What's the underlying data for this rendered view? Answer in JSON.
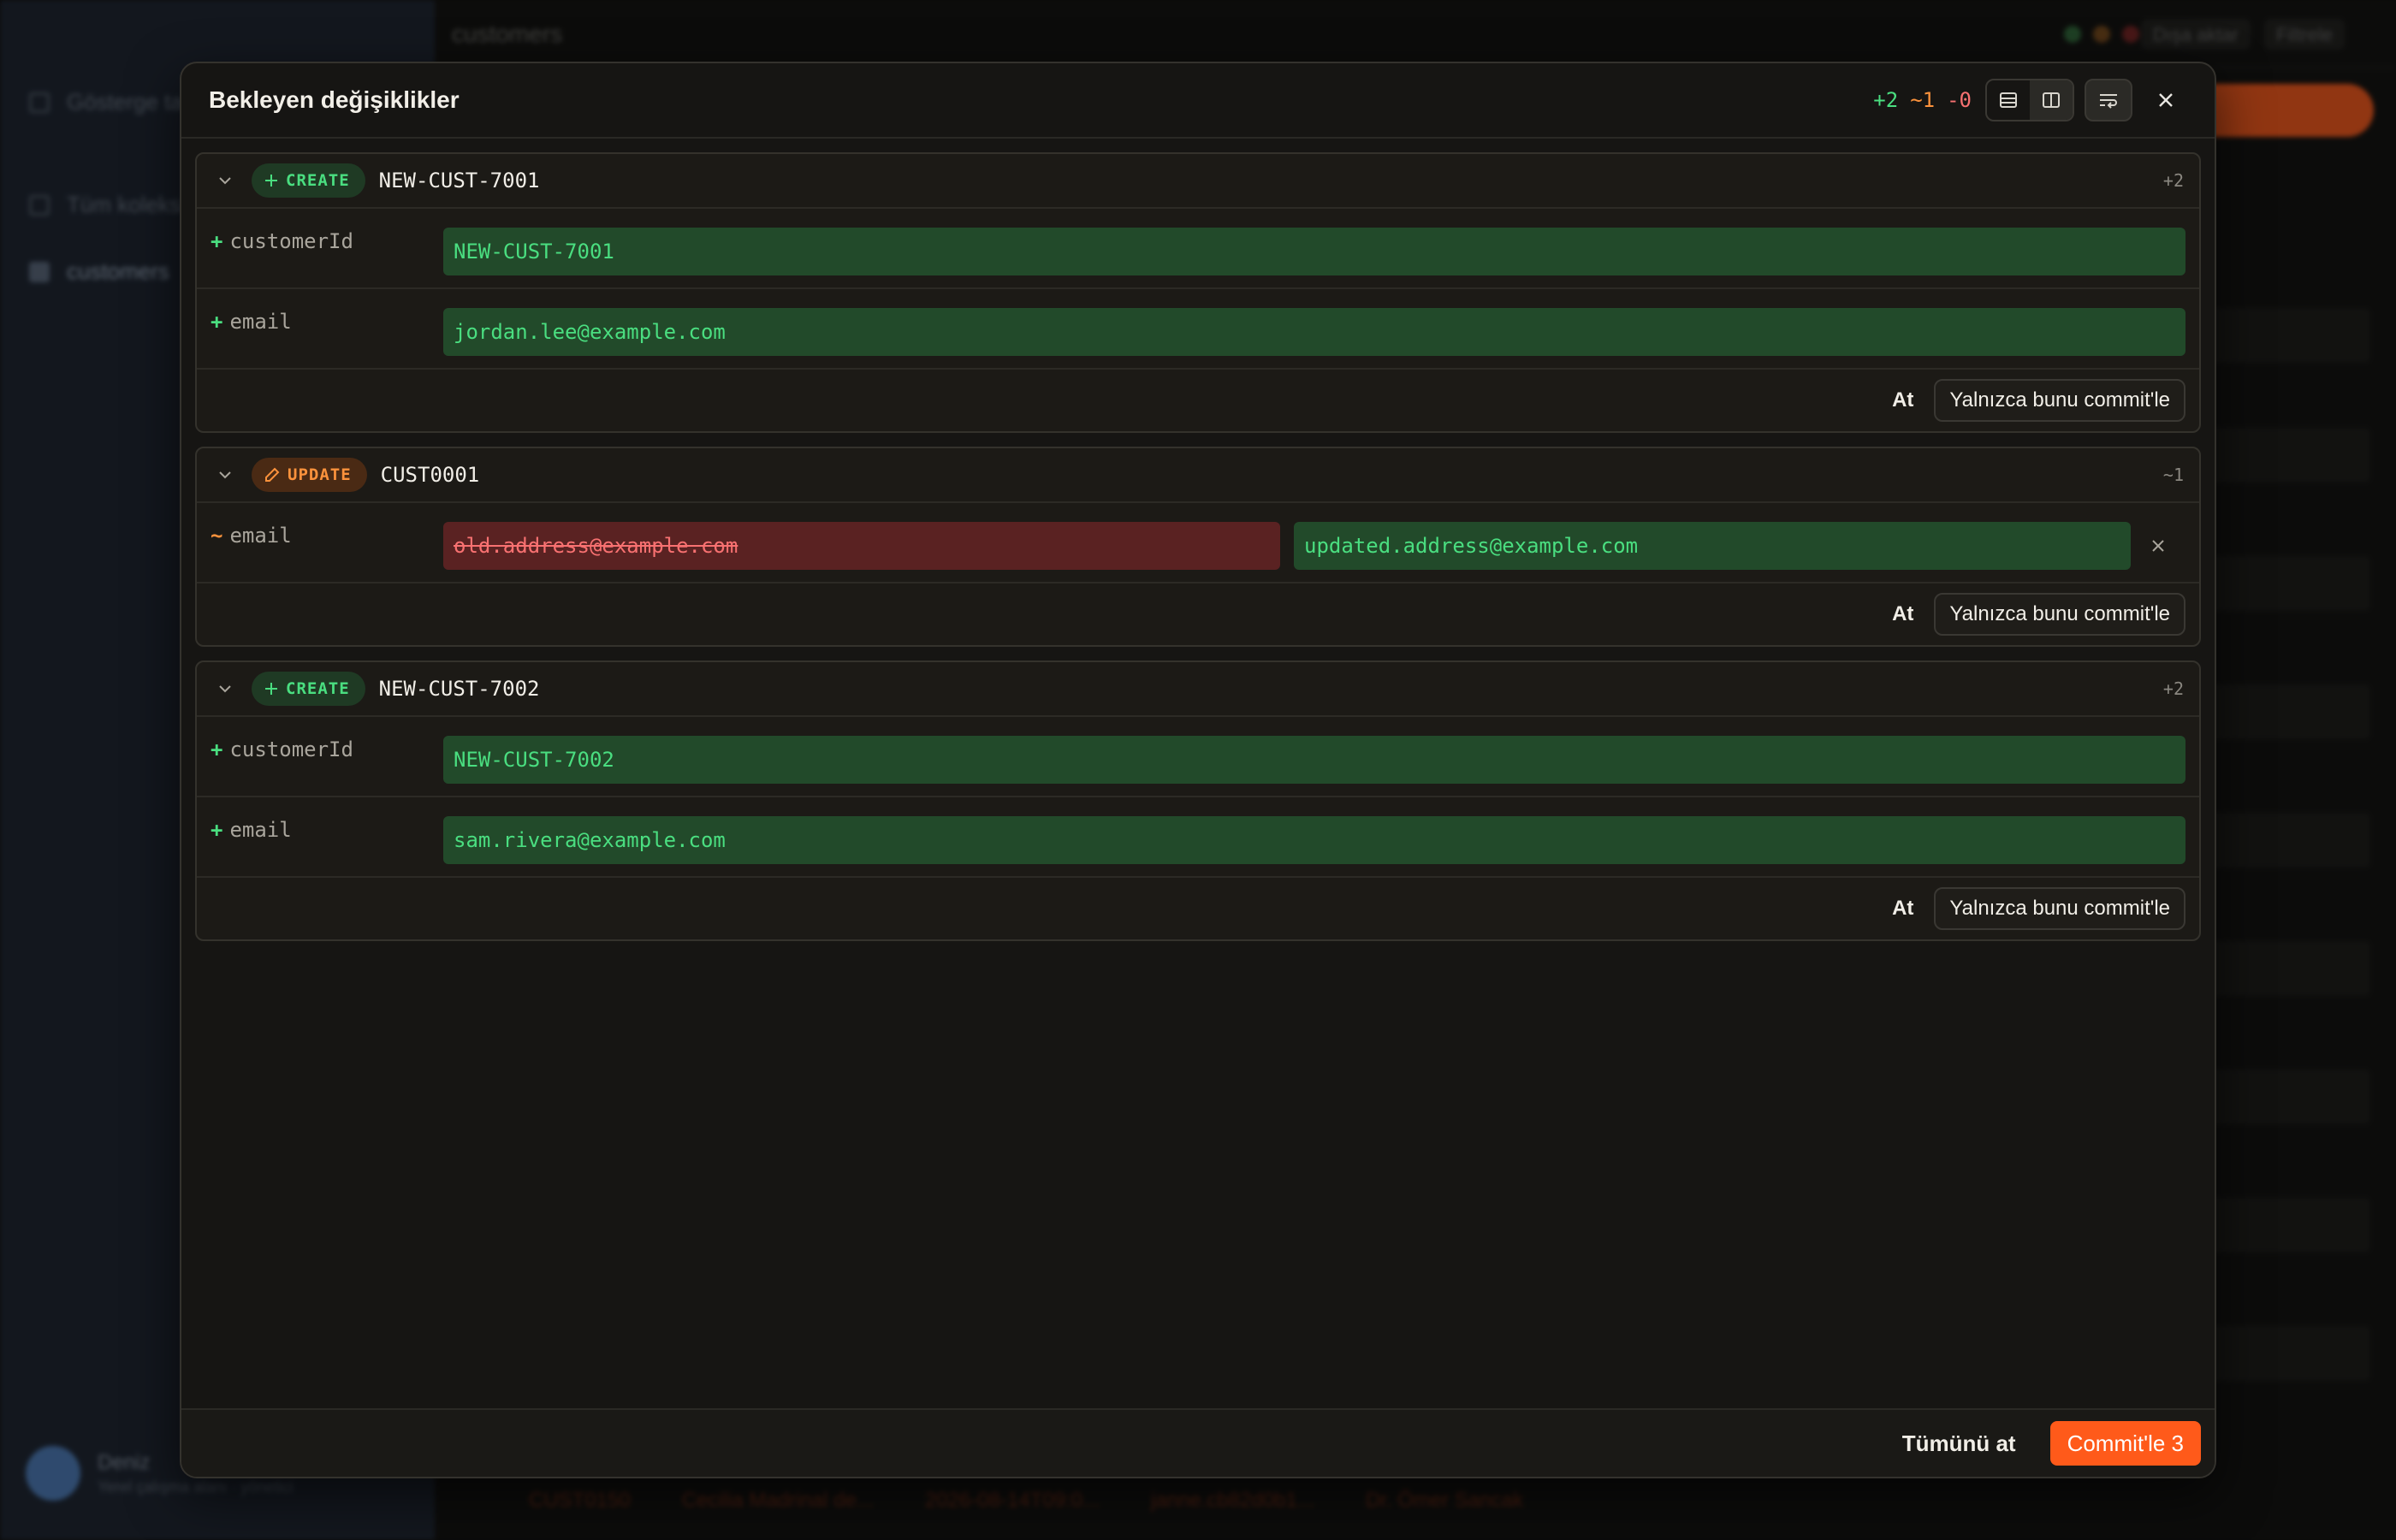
{
  "background": {
    "sidebar_items": [
      "Gösterge tablosu",
      "Tüm koleksiyonlar",
      "customers"
    ],
    "table_title": "customers",
    "top_buttons": [
      "Dışa aktar",
      "Filtrele"
    ],
    "user_name": "Deniz",
    "user_sub": "Yerel çalışma alanı · yönetici",
    "bottom_row": [
      "CUST0150",
      "Cecilia Madrinal de...",
      "2026-08-14T09:0...",
      "janne.cb82d0b1...",
      "Dr. Ömer Sancak"
    ]
  },
  "modal": {
    "title": "Bekleyen değişiklikler",
    "counts": {
      "added": "+2",
      "modified": "~1",
      "deleted": "-0"
    },
    "changes": [
      {
        "action": "CREATE",
        "record_id": "NEW-CUST-7001",
        "count": "+2",
        "fields": [
          {
            "mark": "+",
            "name": "customerId",
            "value": "NEW-CUST-7001"
          },
          {
            "mark": "+",
            "name": "email",
            "value": "jordan.lee@example.com"
          }
        ]
      },
      {
        "action": "UPDATE",
        "record_id": "CUST0001",
        "count": "~1",
        "fields": [
          {
            "mark": "~",
            "name": "email",
            "old_value": "old.address@example.com",
            "new_value": "updated.address@example.com"
          }
        ]
      },
      {
        "action": "CREATE",
        "record_id": "NEW-CUST-7002",
        "count": "+2",
        "fields": [
          {
            "mark": "+",
            "name": "customerId",
            "value": "NEW-CUST-7002"
          },
          {
            "mark": "+",
            "name": "email",
            "value": "sam.rivera@example.com"
          }
        ]
      }
    ],
    "discard_label": "At",
    "commit_only_label": "Yalnızca bunu commit'le",
    "discard_all_label": "Tümünü at",
    "commit_all_label": "Commit'le 3"
  },
  "colors": {
    "accent": "#ff5a1a",
    "added": "#4ade80",
    "modified": "#fb923c",
    "deleted": "#f87171"
  }
}
